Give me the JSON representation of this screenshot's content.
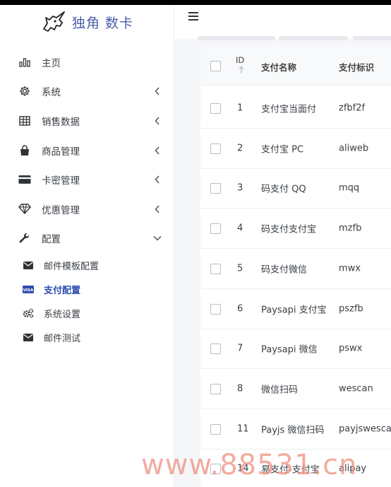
{
  "brand": {
    "name": "独角 数卡"
  },
  "menu": [
    {
      "label": "主页",
      "icon": "bar-chart-icon",
      "expandable": false
    },
    {
      "label": "系统",
      "icon": "gear-icon",
      "expandable": true
    },
    {
      "label": "销售数据",
      "icon": "table-icon",
      "expandable": true
    },
    {
      "label": "商品管理",
      "icon": "shopping-bag-icon",
      "expandable": true
    },
    {
      "label": "卡密管理",
      "icon": "credit-card-icon",
      "expandable": true
    },
    {
      "label": "优惠管理",
      "icon": "diamond-icon",
      "expandable": true
    },
    {
      "label": "配置",
      "icon": "wrench-icon",
      "expandable": true,
      "expanded": true
    }
  ],
  "submenu": [
    {
      "label": "邮件模板配置",
      "icon": "envelope-icon",
      "active": false
    },
    {
      "label": "支付配置",
      "icon": "visa-card-icon",
      "active": true
    },
    {
      "label": "系统设置",
      "icon": "cogs-icon",
      "active": false
    },
    {
      "label": "邮件测试",
      "icon": "envelope-icon",
      "active": false
    }
  ],
  "table": {
    "headers": {
      "id": "ID",
      "name": "支付名称",
      "code": "支付标识"
    },
    "rows": [
      {
        "id": "1",
        "name": "支付宝当面付",
        "code": "zfbf2f"
      },
      {
        "id": "2",
        "name": "支付宝 PC",
        "code": "aliweb"
      },
      {
        "id": "3",
        "name": "码支付 QQ",
        "code": "mqq"
      },
      {
        "id": "4",
        "name": "码支付支付宝",
        "code": "mzfb"
      },
      {
        "id": "5",
        "name": "码支付微信",
        "code": "mwx"
      },
      {
        "id": "6",
        "name": "Paysapi 支付宝",
        "code": "pszfb"
      },
      {
        "id": "7",
        "name": "Paysapi 微信",
        "code": "pswx"
      },
      {
        "id": "8",
        "name": "微信扫码",
        "code": "wescan"
      },
      {
        "id": "11",
        "name": "Payjs 微信扫码",
        "code": "payjswescan"
      },
      {
        "id": "14",
        "name": "易支付-支付宝",
        "code": "alipay"
      }
    ]
  },
  "watermark": "www.88531.cn"
}
